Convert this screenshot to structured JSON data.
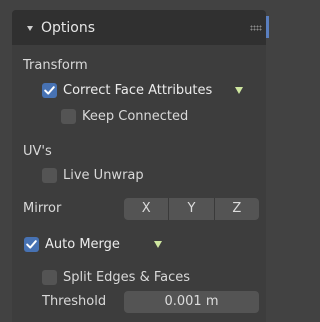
{
  "panel": {
    "title": "Options",
    "header_icon": "grip-dots-icon",
    "collapse_icon": "chevron-down-icon"
  },
  "transform": {
    "heading": "Transform",
    "correct_face_attributes": {
      "label": "Correct Face Attributes",
      "checked": true
    },
    "keep_connected": {
      "label": "Keep Connected",
      "checked": false
    }
  },
  "uvs": {
    "heading": "UV's",
    "live_unwrap": {
      "label": "Live Unwrap",
      "checked": false
    }
  },
  "mirror": {
    "label": "Mirror",
    "buttons": [
      "X",
      "Y",
      "Z"
    ]
  },
  "auto_merge": {
    "label": "Auto Merge",
    "checked": true,
    "split_edges_faces": {
      "label": "Split Edges & Faces",
      "checked": false
    },
    "threshold_label": "Threshold",
    "threshold_value": "0.001 m"
  },
  "colors": {
    "accent": "#4772b3",
    "dropdown_triangle": "#cfe7a0"
  }
}
